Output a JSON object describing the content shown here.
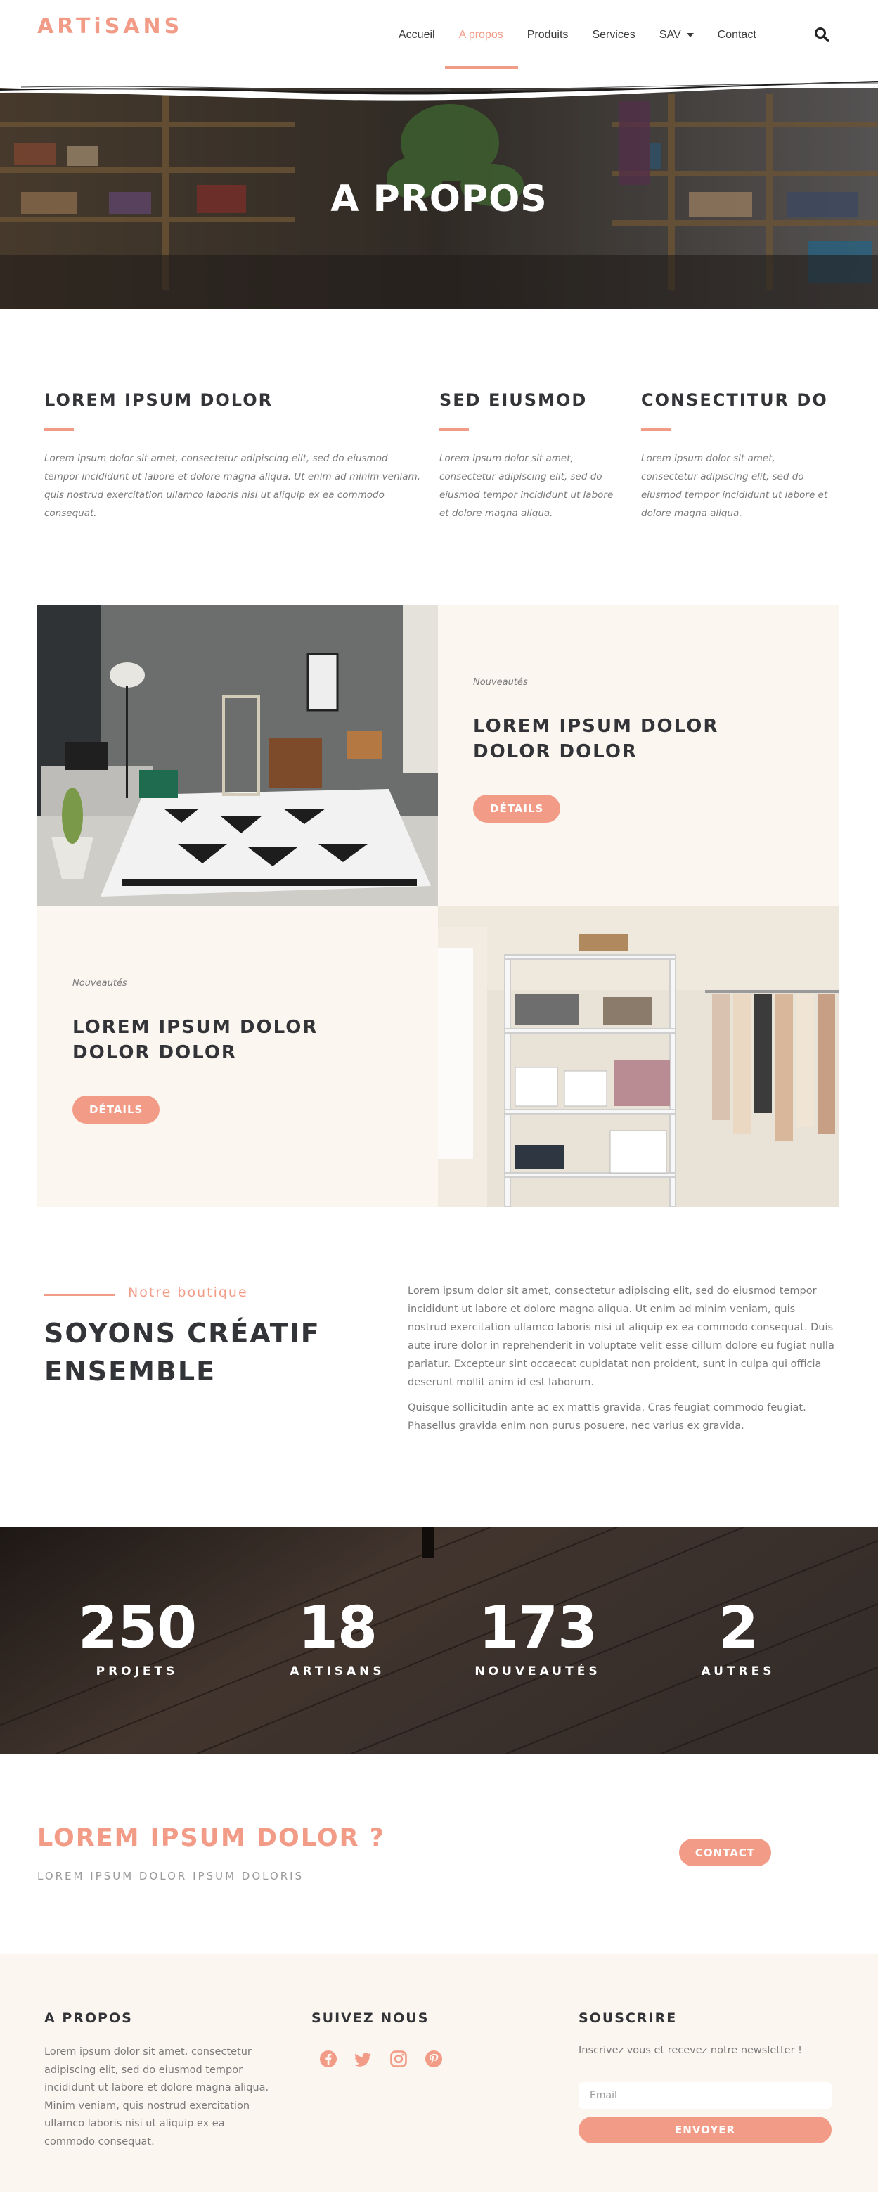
{
  "header": {
    "logo": "ARTiSANS",
    "nav": [
      "Accueil",
      "A propos",
      "Produits",
      "Services",
      "SAV",
      "Contact"
    ],
    "active_item": "A propos"
  },
  "hero": {
    "title": "A PROPOS"
  },
  "intro": {
    "columns": [
      {
        "title": "LOREM IPSUM DOLOR",
        "text": "Lorem ipsum dolor sit amet, consectetur adipiscing elit, sed do eiusmod tempor incididunt ut labore et dolore magna aliqua. Ut enim ad minim veniam, quis nostrud exercitation ullamco laboris nisi ut aliquip ex ea commodo consequat."
      },
      {
        "title": "SED EIUSMOD",
        "text": "Lorem ipsum dolor sit amet, consectetur adipiscing elit, sed do eiusmod tempor incididunt ut labore et dolore magna aliqua."
      },
      {
        "title": "CONSECTITUR DO",
        "text": "Lorem ipsum dolor sit amet, consectetur adipiscing elit, sed do eiusmod tempor incididunt ut labore et dolore magna aliqua."
      }
    ]
  },
  "features": [
    {
      "kicker": "Nouveautés",
      "title": "LOREM IPSUM DOLOR DOLOR DOLOR",
      "button": "DÉTAILS"
    },
    {
      "kicker": "Nouveautés",
      "title": "LOREM IPSUM DOLOR DOLOR DOLOR",
      "button": "DÉTAILS"
    }
  ],
  "boutique": {
    "kicker": "Notre boutique",
    "title": "SOYONS CRÉATIF ENSEMBLE",
    "paragraph_1": "Lorem ipsum dolor sit amet, consectetur adipiscing elit, sed do eiusmod tempor incididunt ut labore et dolore magna aliqua. Ut enim ad minim veniam, quis nostrud exercitation ullamco laboris nisi ut aliquip ex ea commodo consequat. Duis aute irure dolor in reprehenderit in voluptate velit esse cillum dolore eu fugiat nulla pariatur. Excepteur sint occaecat cupidatat non proident, sunt in culpa qui officia deserunt mollit anim id est laborum.",
    "paragraph_2": "Quisque sollicitudin ante ac ex mattis gravida. Cras feugiat commodo feugiat. Phasellus gravida enim non purus posuere, nec varius ex gravida."
  },
  "stats": [
    {
      "value": "250",
      "label": "PROJETS"
    },
    {
      "value": "18",
      "label": "ARTISANS"
    },
    {
      "value": "173",
      "label": "NOUVEAUTÉS"
    },
    {
      "value": "2",
      "label": "AUTRES"
    }
  ],
  "cta": {
    "title": "LOREM IPSUM DOLOR ?",
    "subtitle": "LOREM IPSUM DOLOR IPSUM DOLORIS",
    "button": "CONTACT"
  },
  "footer": {
    "about": {
      "title": "A PROPOS",
      "text": "Lorem ipsum dolor sit amet, consectetur adipiscing elit, sed do eiusmod tempor incididunt ut labore et dolore magna aliqua. Minim veniam, quis nostrud exercitation ullamco laboris nisi ut aliquip ex ea commodo consequat."
    },
    "follow": {
      "title": "SUIVEZ NOUS",
      "icons": [
        "facebook-icon",
        "twitter-icon",
        "instagram-icon",
        "pinterest-icon"
      ]
    },
    "subscribe": {
      "title": "SOUSCRIRE",
      "text": "Inscrivez vous et recevez notre newsletter !",
      "placeholder": "Email",
      "button": "ENVOYER"
    }
  },
  "colors": {
    "accent": "#f29b86",
    "dark_text": "#333438",
    "muted_text": "#7a7a7a",
    "cream": "#fcf6f1"
  }
}
